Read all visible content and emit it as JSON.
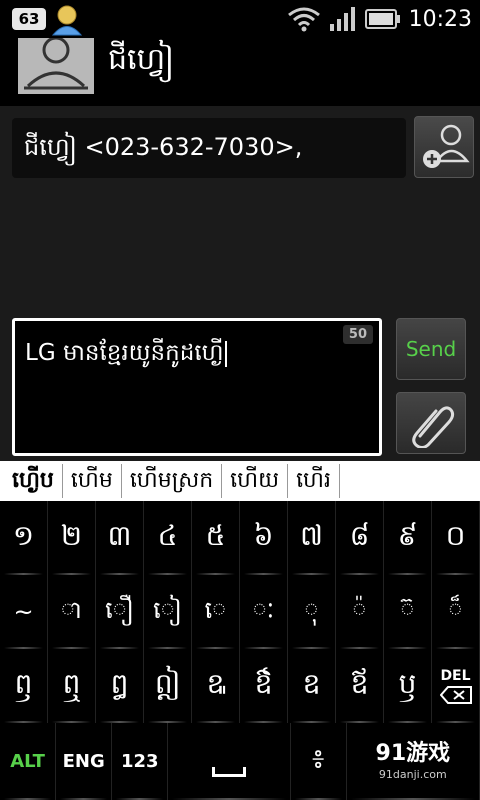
{
  "status_bar": {
    "notification_count": "63",
    "time": "10:23",
    "icons": [
      "contact-notification-icon",
      "wifi-icon",
      "signal-icon",
      "battery-icon"
    ]
  },
  "contact": {
    "name": "ជីហ្វៀ"
  },
  "recipient": {
    "value": "ជីហ្វៀ <023-632-7030>,"
  },
  "compose": {
    "text": "LG មានខ្មែរយូនីកូដហ្ងើ",
    "char_count": "50",
    "send_label": "Send"
  },
  "suggestions": [
    "ហ្ងើប",
    "ហើម",
    "ហើមស្រក",
    "ហើយ",
    "ហើរ"
  ],
  "keyboard": {
    "row1": [
      "១",
      "២",
      "៣",
      "៤",
      "៥",
      "៦",
      "៧",
      "៨",
      "៩",
      "០"
    ],
    "row2": [
      "~",
      "ា",
      "ឿ",
      "ៀ",
      "េ",
      "ៈ",
      "ុ",
      "៉",
      "៊",
      "៏"
    ],
    "row3": [
      "ឭ",
      "ឮ",
      "ឰ",
      "ឦ",
      "ឩ",
      "ឳ",
      "ឧ",
      "ឪ",
      "ឫ"
    ],
    "del_label": "DEL",
    "alt_label": "ALT",
    "eng_label": "ENG",
    "num_label": "123",
    "colon_label": "៖"
  },
  "watermark": {
    "text": "91游戏",
    "url": "91danji.com"
  },
  "colors": {
    "accent_green": "#57d04a",
    "panel": "#1b1b1b",
    "suggestion_bg": "#ffffff"
  }
}
